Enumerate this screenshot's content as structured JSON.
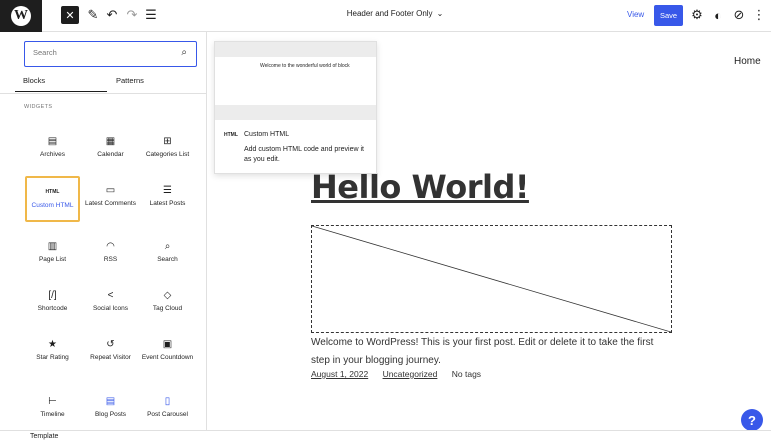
{
  "header": {
    "logo_letter": "W",
    "close_icon": "close-icon",
    "tools": [
      "pencil-icon",
      "undo-icon",
      "redo-icon",
      "list-view-icon"
    ],
    "document_title": "Header and Footer Only",
    "view_label": "View",
    "save_label": "Save",
    "right_icons": [
      "gear-icon",
      "contrast-icon",
      "compass-icon"
    ]
  },
  "inserter": {
    "search_placeholder": "Search",
    "tabs": [
      "Blocks",
      "Patterns"
    ],
    "category": "WIDGETS",
    "blocks": [
      {
        "label": "Archives",
        "icon": "▤"
      },
      {
        "label": "Calendar",
        "icon": "▦"
      },
      {
        "label": "Categories List",
        "icon": "⊞"
      },
      {
        "label": "Custom HTML",
        "icon": "HTML",
        "selected": true
      },
      {
        "label": "Latest Comments",
        "icon": "▭"
      },
      {
        "label": "Latest Posts",
        "icon": "☰"
      },
      {
        "label": "Page List",
        "icon": "▥"
      },
      {
        "label": "RSS",
        "icon": "◠"
      },
      {
        "label": "Search",
        "icon": "⌕"
      },
      {
        "label": "Shortcode",
        "icon": "[/]"
      },
      {
        "label": "Social Icons",
        "icon": "<"
      },
      {
        "label": "Tag Cloud",
        "icon": "◇"
      },
      {
        "label": "Star Rating",
        "icon": "★"
      },
      {
        "label": "Repeat Visitor",
        "icon": "↺"
      },
      {
        "label": "Event Countdown",
        "icon": "▣"
      },
      {
        "label": "Timeline",
        "icon": "⊢"
      },
      {
        "label": "Blog Posts",
        "icon": "▤"
      },
      {
        "label": "Post Carousel",
        "icon": "▯"
      }
    ]
  },
  "preview": {
    "sample_text": "Welcome to the wonderful world of block",
    "icon_text": "HTML",
    "title": "Custom HTML",
    "description": "Add custom HTML code and preview it as you edit."
  },
  "canvas": {
    "nav_link": "Home",
    "post_title": "Hello World!",
    "excerpt": "Welcome to WordPress! This is your first post. Edit or delete it to take the first step in your blogging journey.",
    "date": "August 1, 2022",
    "category": "Uncategorized",
    "tags": "No tags",
    "help_label": "?"
  },
  "footer": {
    "breadcrumb": "Template"
  },
  "colors": {
    "accent": "#3858e9",
    "selection": "#f0b849",
    "toolbar_dark": "#1e1e1e"
  }
}
